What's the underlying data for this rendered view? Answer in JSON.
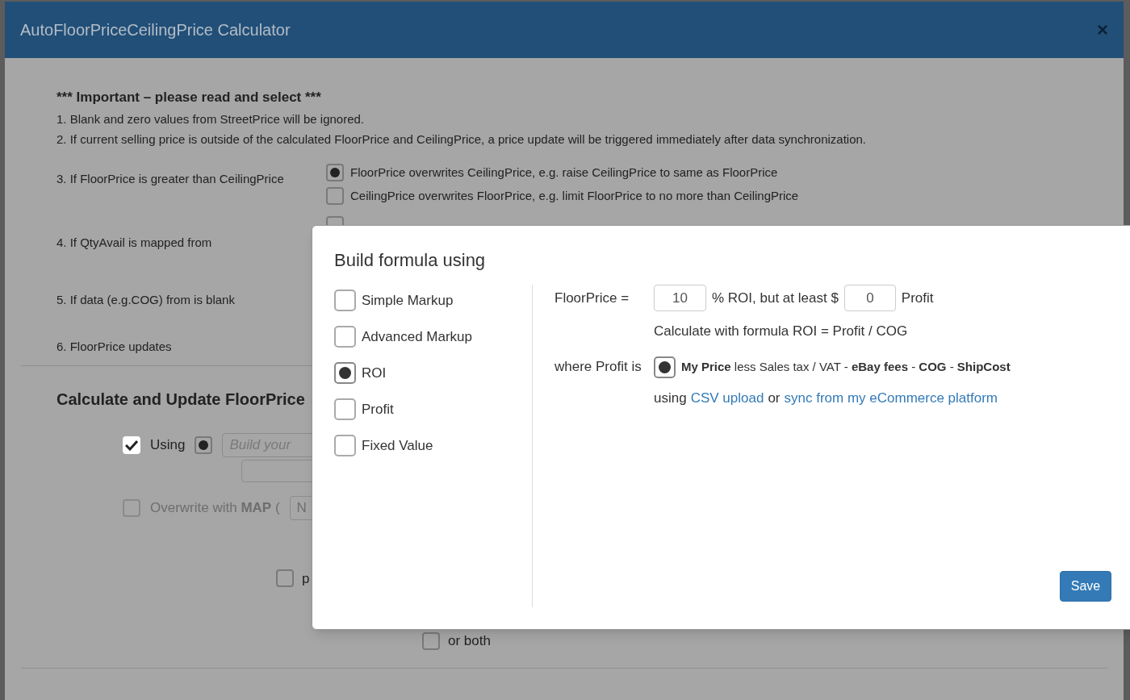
{
  "modal": {
    "title": "AutoFloorPriceCeilingPrice Calculator",
    "close": "×",
    "heading": "*** Important – please read and select ***",
    "notes": [
      "1. Blank and zero values from StreetPrice will be ignored.",
      "2. If current selling price is outside of the calculated FloorPrice and CeilingPrice, a price update will be triggered immediately after data synchronization."
    ],
    "settings": [
      {
        "label": "3. If FloorPrice is greater than CeilingPrice",
        "options": [
          {
            "label": "FloorPrice overwrites CeilingPrice, e.g. raise CeilingPrice to same as FloorPrice",
            "selected": true
          },
          {
            "label": "CeilingPrice overwrites FloorPrice, e.g. limit FloorPrice to no more than CeilingPrice",
            "selected": false
          }
        ]
      },
      {
        "label": "4. If QtyAvail is mapped from",
        "options": [
          {
            "selected": false
          }
        ]
      },
      {
        "label": "5. If data (e.g.COG) from is blank"
      },
      {
        "label": "6. FloorPrice updates"
      }
    ],
    "section": {
      "title": "Calculate and Update FloorPrice",
      "using": {
        "label": "Using",
        "checked": true
      },
      "source_radio": {
        "selected": true
      },
      "formula_field": {
        "placeholder": "Build your"
      },
      "overwrite": {
        "label": "Overwrite with **MAP** (",
        "checked": false,
        "disabled": true,
        "field_placeholder": "N"
      },
      "extra_options": [
        {
          "label": "p",
          "checked": false
        },
        {
          "label": "or both",
          "checked": false
        }
      ]
    }
  },
  "formula_dialog": {
    "title": "Build formula using",
    "methods": [
      {
        "label": "Simple Markup",
        "selected": false
      },
      {
        "label": "Advanced Markup",
        "selected": false
      },
      {
        "label": "ROI",
        "selected": true
      },
      {
        "label": "Profit",
        "selected": false
      },
      {
        "label": "Fixed Value",
        "selected": false
      }
    ],
    "formula": {
      "label": "FloorPrice =",
      "roi_value": "10",
      "roi_text": "% ROI, but at least $",
      "min_profit_value": "0",
      "profit_text": "Profit",
      "note": "Calculate with formula ROI = Profit / COG",
      "where_label": "where Profit is",
      "profit_radio_selected": true,
      "profit_formula": "**My Price** less Sales tax / VAT - **eBay fees** - **COG** - **ShipCost**",
      "using_text": "using",
      "csv_link": "CSV upload",
      "or_text": "or",
      "sync_link": "sync from my eCommerce platform"
    },
    "save": "Save"
  }
}
